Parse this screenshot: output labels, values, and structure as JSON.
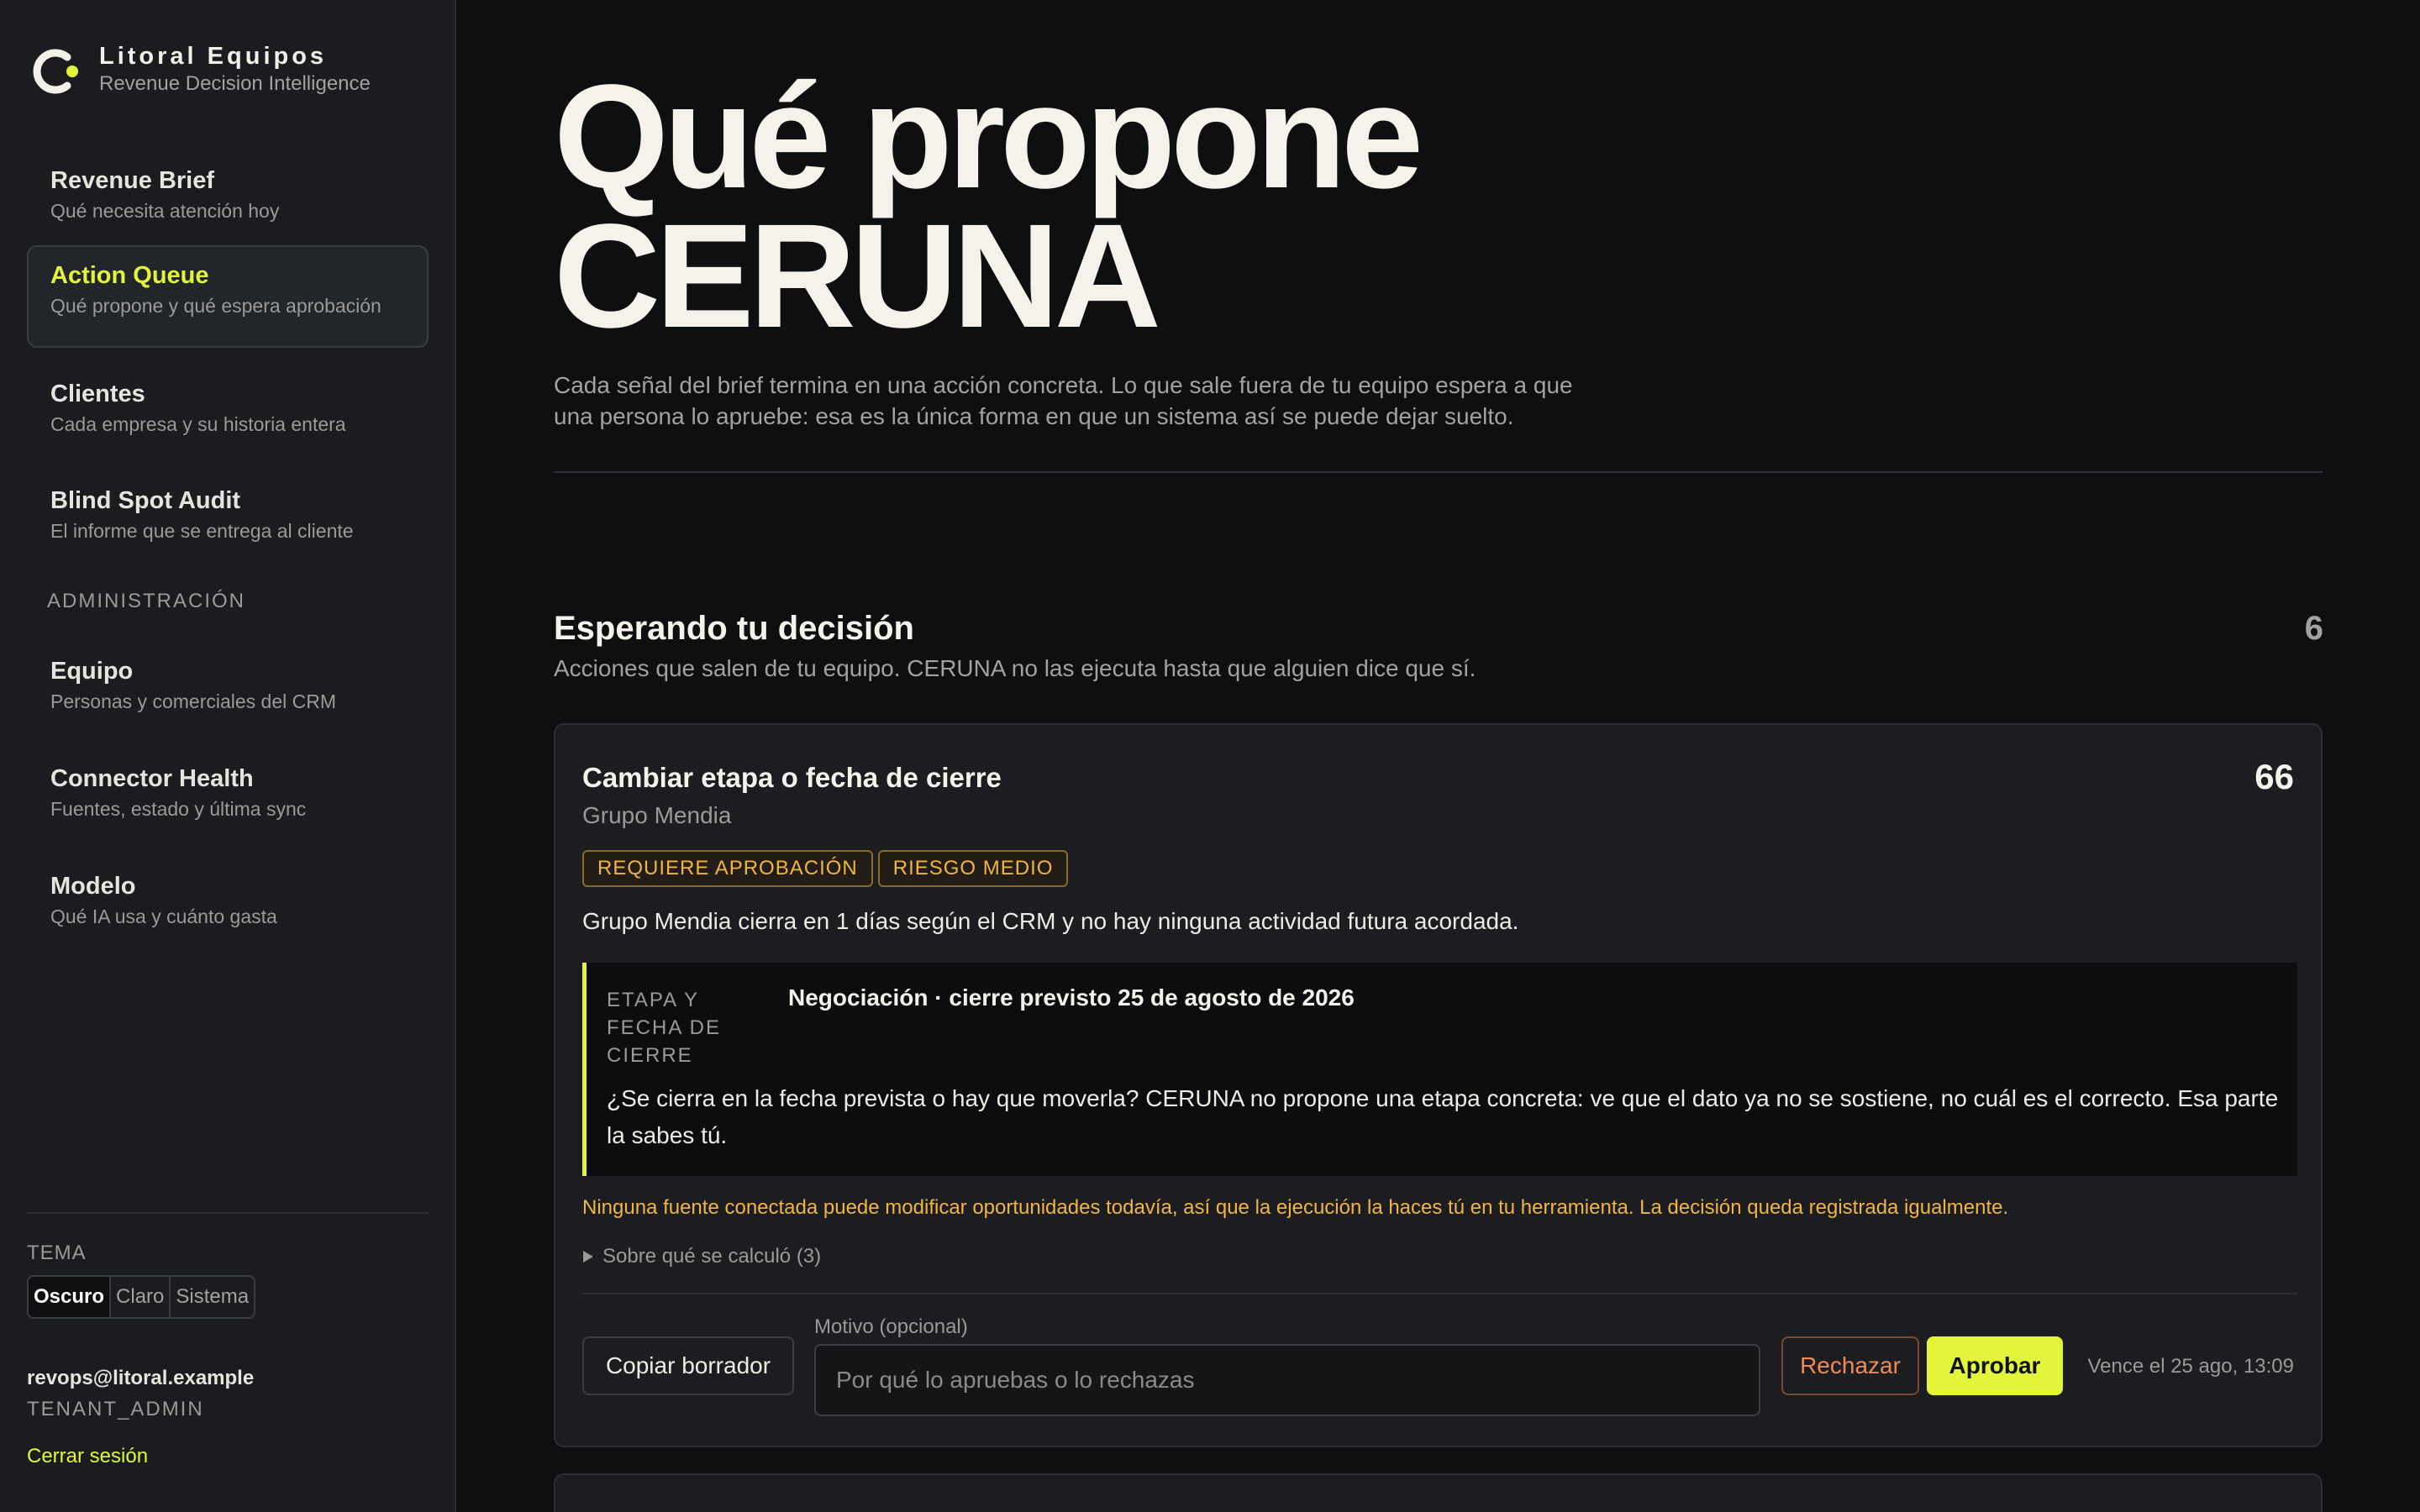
{
  "brand": {
    "name": "Litoral Equipos",
    "subtitle": "Revenue Decision Intelligence",
    "accent": "#e3f53a"
  },
  "sidebar": {
    "items": [
      {
        "label": "Revenue Brief",
        "sub": "Qué necesita atención hoy",
        "active": false
      },
      {
        "label": "Action Queue",
        "sub": "Qué propone y qué espera aprobación",
        "active": true
      },
      {
        "label": "Clientes",
        "sub": "Cada empresa y su historia entera",
        "active": false
      },
      {
        "label": "Blind Spot Audit",
        "sub": "El informe que se entrega al cliente",
        "active": false
      }
    ],
    "admin_label": "ADMINISTRACIÓN",
    "admin_items": [
      {
        "label": "Equipo",
        "sub": "Personas y comerciales del CRM"
      },
      {
        "label": "Connector Health",
        "sub": "Fuentes, estado y última sync"
      },
      {
        "label": "Modelo",
        "sub": "Qué IA usa y cuánto gasta"
      }
    ],
    "theme_label": "TEMA",
    "theme_options": [
      "Oscuro",
      "Claro",
      "Sistema"
    ],
    "theme_selected": "Oscuro",
    "user_email": "revops@litoral.example",
    "user_role": "TENANT_ADMIN",
    "logout_label": "Cerrar sesión"
  },
  "hero": {
    "title_line1": "Qué propone",
    "title_line2": "CERUNA",
    "description": "Cada señal del brief termina en una acción concreta. Lo que sale fuera de tu equipo espera a que una persona lo apruebe: esa es la única forma en que un sistema así se puede dejar suelto."
  },
  "section": {
    "title": "Esperando tu decisión",
    "count": "6",
    "subtitle": "Acciones que salen de tu equipo. CERUNA no las ejecuta hasta que alguien dice que sí."
  },
  "card": {
    "title": "Cambiar etapa o fecha de cierre",
    "score": "66",
    "company": "Grupo Mendia",
    "badges": [
      "REQUIERE APROBACIÓN",
      "RIESGO MEDIO"
    ],
    "message": "Grupo Mendia cierra en 1 días según el CRM y no hay ninguna actividad futura acordada.",
    "detail_label": "ETAPA Y FECHA DE CIERRE",
    "detail_value": "Negociación · cierre previsto 25 de agosto de 2026",
    "detail_text": "¿Se cierra en la fecha prevista o hay que moverla? CERUNA no propone una etapa concreta: ve que el dato ya no se sostiene, no cuál es el correcto. Esa parte la sabes tú.",
    "warning": "Ninguna fuente conectada puede modificar oportunidades todavía, así que la ejecución la haces tú en tu herramienta. La decisión queda registrada igualmente.",
    "disclosure": "Sobre qué se calculó (3)",
    "copy_label": "Copiar borrador",
    "motivo_label": "Motivo (opcional)",
    "motivo_placeholder": "Por qué lo apruebas o lo rechazas",
    "motivo_value": "",
    "reject_label": "Rechazar",
    "approve_label": "Aprobar",
    "due": "Vence el 25 ago, 13:09"
  }
}
